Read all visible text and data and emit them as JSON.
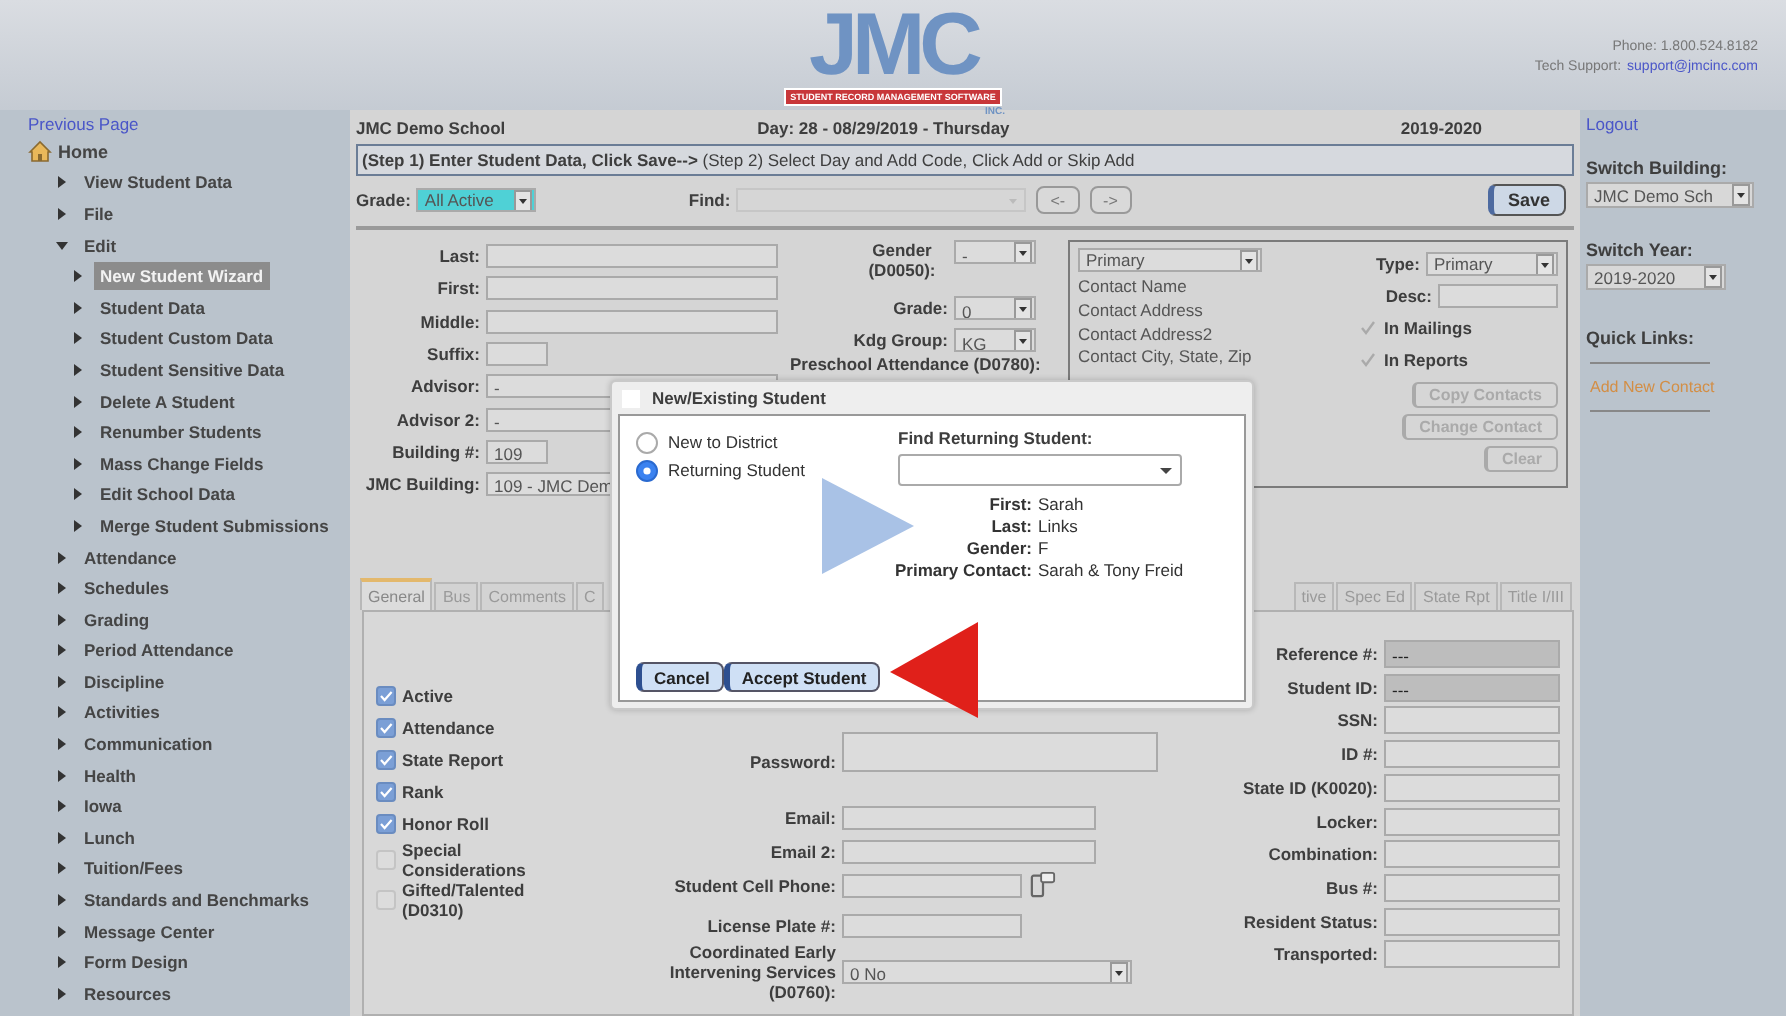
{
  "header": {
    "logo": {
      "letters": "JMC",
      "banner": "STUDENT RECORD MANAGEMENT SOFTWARE",
      "suffix": "INC."
    },
    "phone": "Phone: 1.800.524.8182",
    "support_label": "Tech Support:",
    "support_link": "support@jmcinc.com"
  },
  "sidebar": {
    "previous_page": "Previous Page",
    "home": {
      "label": "Home",
      "children": [
        {
          "label": "View Student Data",
          "expanded": false,
          "selected": false
        },
        {
          "label": "File",
          "expanded": false,
          "selected": false
        },
        {
          "label": "Edit",
          "expanded": true,
          "selected": false,
          "children": [
            {
              "label": "New Student Wizard",
              "expanded": false,
              "selected": true
            },
            {
              "label": "Student Data",
              "expanded": false,
              "selected": false
            },
            {
              "label": "Student Custom Data",
              "expanded": false,
              "selected": false
            },
            {
              "label": "Student Sensitive Data",
              "expanded": false,
              "selected": false
            },
            {
              "label": "Delete A Student",
              "expanded": false,
              "selected": false
            },
            {
              "label": "Renumber Students",
              "expanded": false,
              "selected": false
            },
            {
              "label": "Mass Change Fields",
              "expanded": false,
              "selected": false
            },
            {
              "label": "Edit School Data",
              "expanded": false,
              "selected": false
            },
            {
              "label": "Merge Student Submissions",
              "expanded": false,
              "selected": false
            }
          ]
        },
        {
          "label": "Attendance",
          "expanded": false,
          "selected": false
        },
        {
          "label": "Schedules",
          "expanded": false,
          "selected": false
        },
        {
          "label": "Grading",
          "expanded": false,
          "selected": false
        },
        {
          "label": "Period Attendance",
          "expanded": false,
          "selected": false
        },
        {
          "label": "Discipline",
          "expanded": false,
          "selected": false
        },
        {
          "label": "Activities",
          "expanded": false,
          "selected": false
        },
        {
          "label": "Communication",
          "expanded": false,
          "selected": false
        },
        {
          "label": "Health",
          "expanded": false,
          "selected": false
        },
        {
          "label": "Iowa",
          "expanded": false,
          "selected": false
        },
        {
          "label": "Lunch",
          "expanded": false,
          "selected": false
        },
        {
          "label": "Tuition/Fees",
          "expanded": false,
          "selected": false
        },
        {
          "label": "Standards and Benchmarks",
          "expanded": false,
          "selected": false
        },
        {
          "label": "Message Center",
          "expanded": false,
          "selected": false
        },
        {
          "label": "Form Design",
          "expanded": false,
          "selected": false
        },
        {
          "label": "Resources",
          "expanded": false,
          "selected": false
        }
      ]
    }
  },
  "school_bar": {
    "school": "JMC Demo School",
    "day": "Day: 28 - 08/29/2019 - Thursday",
    "year": "2019-2020"
  },
  "steps": "**(Step 1) Enter Student Data, Click Save-->** (Step 2) Select Day and Add Code, Click Add or Skip Add",
  "toolbar": {
    "grade_label": "Grade:",
    "grade_value": "All Active",
    "find_label": "Find:",
    "prev": "<-",
    "next": "->",
    "save": "Save"
  },
  "student": {
    "left": [
      {
        "label": "Last:",
        "kind": "text"
      },
      {
        "label": "First:",
        "kind": "text"
      },
      {
        "label": "Middle:",
        "kind": "text"
      },
      {
        "label": "Suffix:",
        "kind": "short"
      },
      {
        "label": "Advisor:",
        "kind": "text",
        "value": "-"
      },
      {
        "label": "Advisor 2:",
        "kind": "text",
        "value": "-"
      },
      {
        "label": "Building #:",
        "kind": "short",
        "value": "109"
      },
      {
        "label": "JMC Building:",
        "kind": "select",
        "value": "109 - JMC Dem"
      }
    ],
    "middle": [
      {
        "label": "Gender (D0050):",
        "kind": "select",
        "value": "-"
      },
      {
        "label": "Grade:",
        "kind": "select",
        "value": "0"
      },
      {
        "label": "Kdg Group:",
        "kind": "select",
        "value": "KG"
      },
      {
        "label": "Preschool Attendance (D0780):",
        "kind": "label"
      }
    ]
  },
  "contacts": {
    "contact_select": "Primary",
    "lines": [
      "Contact Name",
      "Contact Address",
      "Contact Address2",
      "Contact City, State, Zip"
    ],
    "type_label": "Type:",
    "type_value": "Primary",
    "desc_label": "Desc:",
    "options": [
      {
        "label": "In Mailings",
        "checked": true
      },
      {
        "label": "In Reports",
        "checked": true
      }
    ],
    "buttons": [
      {
        "label": "Copy Contacts",
        "disabled": true
      },
      {
        "label": "Change Contact",
        "disabled": true
      },
      {
        "label": "Clear",
        "disabled": true
      }
    ]
  },
  "tabs_left": [
    {
      "label": "General",
      "selected": true
    },
    {
      "label": "Bus",
      "selected": false
    },
    {
      "label": "Comments",
      "selected": false
    },
    {
      "label": "C",
      "selected": false
    }
  ],
  "tabs_right": [
    {
      "label": "tive",
      "selected": false
    },
    {
      "label": "Spec Ed",
      "selected": false
    },
    {
      "label": "State Rpt",
      "selected": false
    },
    {
      "label": "Title I/III",
      "selected": false
    }
  ],
  "general": {
    "flags": [
      {
        "label": "Active",
        "checked": true
      },
      {
        "label": "Attendance",
        "checked": true
      },
      {
        "label": "State Report",
        "checked": true
      },
      {
        "label": "Rank",
        "checked": true
      },
      {
        "label": "Honor Roll",
        "checked": true
      },
      {
        "label": "Special Considerations",
        "checked": false
      },
      {
        "label": "Gifted/Talented (D0310)",
        "checked": false
      }
    ],
    "middle": [
      {
        "label": "Password:",
        "kind": "tall"
      },
      {
        "label": "Email:",
        "kind": "text"
      },
      {
        "label": "Email 2:",
        "kind": "text"
      },
      {
        "label": "Student Cell Phone:",
        "kind": "phone"
      },
      {
        "label": "License Plate #:",
        "kind": "short"
      },
      {
        "label": "Coordinated Early Intervening Services (D0760):",
        "kind": "select",
        "value": "0 No"
      }
    ],
    "right": [
      {
        "label": "Reference #:",
        "kind": "readonly",
        "value": "---"
      },
      {
        "label": "Student ID:",
        "kind": "readonly",
        "value": "---"
      },
      {
        "label": "SSN:",
        "kind": "text"
      },
      {
        "label": "ID #:",
        "kind": "text"
      },
      {
        "label": "State ID (K0020):",
        "kind": "text"
      },
      {
        "label": "Locker:",
        "kind": "text"
      },
      {
        "label": "Combination:",
        "kind": "text"
      },
      {
        "label": "Bus #:",
        "kind": "text"
      },
      {
        "label": "Resident Status:",
        "kind": "text"
      },
      {
        "label": "Transported:",
        "kind": "text"
      }
    ]
  },
  "right_panel": {
    "logout": "Logout",
    "building_label": "Switch Building:",
    "building_value": "JMC Demo Sch",
    "year_label": "Switch Year:",
    "year_value": "2019-2020",
    "quick_links_label": "Quick Links:",
    "links": [
      "Add New Contact"
    ]
  },
  "dialog": {
    "title": "New/Existing Student",
    "options": [
      {
        "label": "New to District",
        "selected": false
      },
      {
        "label": "Returning Student",
        "selected": true
      }
    ],
    "find_label": "Find Returning Student:",
    "details": [
      {
        "label": "First:",
        "value": "Sarah"
      },
      {
        "label": "Last:",
        "value": "Links"
      },
      {
        "label": "Gender:",
        "value": "F"
      },
      {
        "label": "Primary Contact:",
        "value": "Sarah & Tony Freid"
      }
    ],
    "buttons": [
      "Cancel",
      "Accept Student"
    ]
  }
}
